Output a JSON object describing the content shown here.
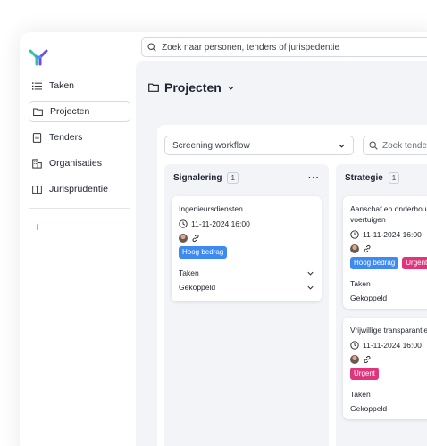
{
  "topbar": {
    "search_placeholder": "Zoek naar personen, tenders of jurispedentie"
  },
  "sidebar": {
    "items": [
      {
        "label": "Taken",
        "icon": "list-icon"
      },
      {
        "label": "Projecten",
        "icon": "folder-icon",
        "active": true
      },
      {
        "label": "Tenders",
        "icon": "document-icon"
      },
      {
        "label": "Organisaties",
        "icon": "building-icon"
      },
      {
        "label": "Jurisprudentie",
        "icon": "book-icon"
      }
    ],
    "add_label": "+"
  },
  "page": {
    "title": "Projecten"
  },
  "board": {
    "workflow_select": "Screening workflow",
    "search_placeholder": "Zoek tenders",
    "columns": [
      {
        "name": "Signalering",
        "count": "1",
        "menu": "···",
        "cards": [
          {
            "title": "Ingenieursdiensten",
            "date": "11-11-2024 16:00",
            "badges": [
              {
                "label": "Hoog bedrag",
                "color": "#3d8bf2"
              }
            ],
            "sections": [
              "Taken",
              "Gekoppeld"
            ]
          }
        ]
      },
      {
        "name": "Strategie",
        "count": "1",
        "cards": [
          {
            "title": "Aanschaf en onderhoud NICU voertuigen",
            "date": "11-11-2024 16:00",
            "badges": [
              {
                "label": "Hoog bedrag",
                "color": "#3d8bf2"
              },
              {
                "label": "Urgent",
                "color": "#e0357d"
              }
            ],
            "sections": [
              "Taken",
              "Gekoppeld"
            ]
          },
          {
            "title": "Vrijwillige transparantie apparatuur",
            "date": "11-11-2024 16:00",
            "badges": [
              {
                "label": "Urgent",
                "color": "#e0357d"
              }
            ],
            "sections": [
              "Taken",
              "Gekoppeld"
            ]
          }
        ]
      }
    ]
  }
}
